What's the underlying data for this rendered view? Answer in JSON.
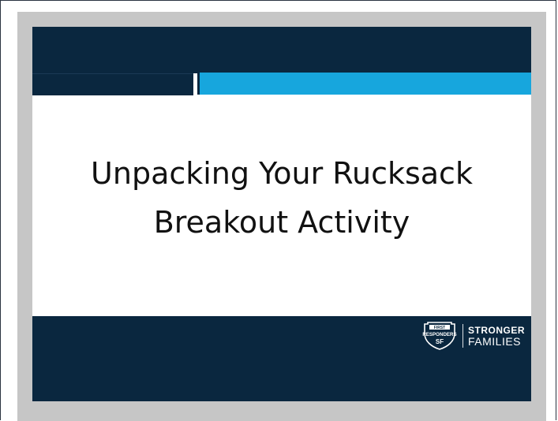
{
  "slide": {
    "title_line1": "Unpacking Your Rucksack",
    "title_line2": "Breakout Activity"
  },
  "logo": {
    "badge_top": "FIRST",
    "badge_middle": "RESPONDERS",
    "badge_bottom": "SF",
    "brand_line1": "STRONGER",
    "brand_line2": "FAMILIES",
    "icon": "shield-icon"
  },
  "colors": {
    "navy": "#0a273f",
    "accent_blue": "#17a6dd",
    "border_gray": "#c6c6c6",
    "text": "#111111"
  }
}
